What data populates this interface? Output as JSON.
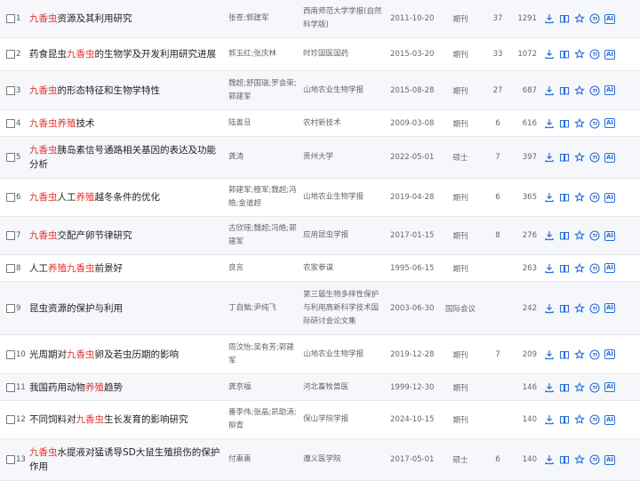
{
  "colors": {
    "accent": "#2b6fd6",
    "highlight": "#e4322b",
    "row_alt": "#f5f7fb"
  },
  "row_actions": [
    "download-icon",
    "read-online-icon",
    "favorite-icon",
    "quote-icon",
    "ai-icon"
  ],
  "ai_label": "AI",
  "rows": [
    {
      "num": "1",
      "title": [
        {
          "t": "九香虫",
          "hl": true
        },
        {
          "t": "资源及其利用研究",
          "hl": false
        }
      ],
      "authors": "张苍;郭建军",
      "source": "西南师范大学学报(自然科学版)",
      "date": "2011-10-20",
      "type": "期刊",
      "cited": "37",
      "downloads": "1291"
    },
    {
      "num": "2",
      "title": [
        {
          "t": "药食昆虫",
          "hl": false
        },
        {
          "t": "九香虫",
          "hl": true
        },
        {
          "t": "的生物学及开发利用研究进展",
          "hl": false
        }
      ],
      "authors": "郭玉红;张庆林",
      "source": "时珍国医国药",
      "date": "2015-03-20",
      "type": "期刊",
      "cited": "33",
      "downloads": "1072"
    },
    {
      "num": "3",
      "title": [
        {
          "t": "九香虫",
          "hl": true
        },
        {
          "t": "的形态特征和生物学特性",
          "hl": false
        }
      ],
      "authors": "魏超;舒国瑞;罗会荣;郭建军",
      "source": "山地农业生物学报",
      "date": "2015-08-28",
      "type": "期刊",
      "cited": "27",
      "downloads": "687"
    },
    {
      "num": "4",
      "title": [
        {
          "t": "九香虫",
          "hl": true
        },
        {
          "t": "养殖",
          "hl": true
        },
        {
          "t": "技术",
          "hl": false
        }
      ],
      "authors": "陆善旦",
      "source": "农村新技术",
      "date": "2009-03-08",
      "type": "期刊",
      "cited": "6",
      "downloads": "616"
    },
    {
      "num": "5",
      "title": [
        {
          "t": "九香虫",
          "hl": true
        },
        {
          "t": "胰岛素信号通路相关基因的表达及功能分析",
          "hl": false
        }
      ],
      "authors": "龚涛",
      "source": "贵州大学",
      "date": "2022-05-01",
      "type": "硕士",
      "cited": "7",
      "downloads": "397"
    },
    {
      "num": "6",
      "title": [
        {
          "t": "九香虫",
          "hl": true
        },
        {
          "t": "人工",
          "hl": false
        },
        {
          "t": "养殖",
          "hl": true
        },
        {
          "t": "越冬条件的优化",
          "hl": false
        }
      ],
      "authors": "郭建军;檀军;魏超;冯皓;金道超",
      "source": "山地农业生物学报",
      "date": "2019-04-28",
      "type": "期刊",
      "cited": "6",
      "downloads": "365"
    },
    {
      "num": "7",
      "title": [
        {
          "t": "九香虫",
          "hl": true
        },
        {
          "t": "交配产卵节律研究",
          "hl": false
        }
      ],
      "authors": "古欣瑶;魏超;冯皓;郭建军",
      "source": "应用昆虫学报",
      "date": "2017-01-15",
      "type": "期刊",
      "cited": "8",
      "downloads": "276"
    },
    {
      "num": "8",
      "title": [
        {
          "t": "人工",
          "hl": false
        },
        {
          "t": "养殖",
          "hl": true
        },
        {
          "t": "九香虫",
          "hl": true
        },
        {
          "t": "前景好",
          "hl": false
        }
      ],
      "authors": "良言",
      "source": "农家参谋",
      "date": "1995-06-15",
      "type": "期刊",
      "cited": "",
      "downloads": "263"
    },
    {
      "num": "9",
      "title": [
        {
          "t": "昆虫资源的保护与利用",
          "hl": false
        }
      ],
      "authors": "丁自勉;尹纯飞",
      "source": "第三届生物多样性保护与利用高新科学技术国际研讨会论文集",
      "date": "2003-06-30",
      "type": "国际会议",
      "cited": "",
      "downloads": "242"
    },
    {
      "num": "10",
      "title": [
        {
          "t": "光周期对",
          "hl": false
        },
        {
          "t": "九香虫",
          "hl": true
        },
        {
          "t": "卵及若虫历期的影响",
          "hl": false
        }
      ],
      "authors": "周汶怡;吴有芳;郭建军",
      "source": "山地农业生物学报",
      "date": "2019-12-28",
      "type": "期刊",
      "cited": "7",
      "downloads": "209"
    },
    {
      "num": "11",
      "title": [
        {
          "t": "我国药用动物",
          "hl": false
        },
        {
          "t": "养殖",
          "hl": true
        },
        {
          "t": "趋势",
          "hl": false
        }
      ],
      "authors": "龚京福",
      "source": "河北畜牧兽医",
      "date": "1999-12-30",
      "type": "期刊",
      "cited": "",
      "downloads": "146"
    },
    {
      "num": "12",
      "title": [
        {
          "t": "不同饲料对",
          "hl": false
        },
        {
          "t": "九香虫",
          "hl": true
        },
        {
          "t": "生长发育的影响研究",
          "hl": false
        }
      ],
      "authors": "番李伟;张晶;凯助涛;柳青",
      "source": "保山学院学报",
      "date": "2024-10-15",
      "type": "期刊",
      "cited": "",
      "downloads": "140"
    },
    {
      "num": "13",
      "title": [
        {
          "t": "九香虫",
          "hl": true
        },
        {
          "t": "水提液对猛诱导SD大鼠生殖损伤的保护作用",
          "hl": false
        }
      ],
      "authors": "付惠惠",
      "source": "遵义医学院",
      "date": "2017-05-01",
      "type": "硕士",
      "cited": "6",
      "downloads": "140"
    }
  ]
}
